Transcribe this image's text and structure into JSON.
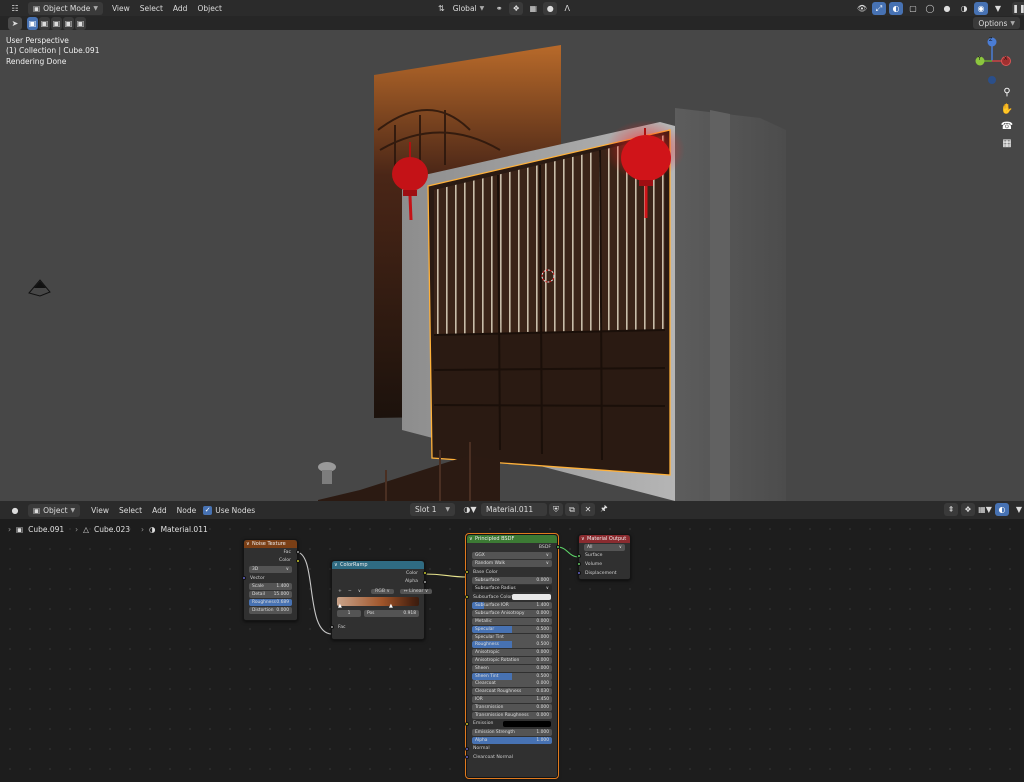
{
  "viewport_header": {
    "mode": "Object Mode",
    "menu": [
      "View",
      "Select",
      "Add",
      "Object"
    ],
    "orientation": "Global",
    "options_label": "Options"
  },
  "viewport": {
    "info": [
      "User Perspective",
      "(1) Collection | Cube.091",
      "Rendering Done"
    ],
    "gizmo": {
      "z": "Z",
      "y": "Y",
      "x": "X"
    }
  },
  "node_header": {
    "type": "Object",
    "menu": [
      "View",
      "Select",
      "Add",
      "Node"
    ],
    "use_nodes_label": "Use Nodes",
    "slot": "Slot 1",
    "material": "Material.011"
  },
  "breadcrumb": [
    "Cube.091",
    "Cube.023",
    "Material.011"
  ],
  "colors": {
    "accent": "#4772b3",
    "selection": "#e07a1e",
    "lantern": "#d4141b"
  },
  "nodes": {
    "noise": {
      "title": "Noise Texture",
      "outputs": [
        "Fac",
        "Color"
      ],
      "dimensions": "3D",
      "vector_label": "Vector",
      "fields": [
        {
          "label": "Scale",
          "value": "1.400"
        },
        {
          "label": "Detail",
          "value": "15.000"
        },
        {
          "label": "Roughness",
          "value": "0.689"
        },
        {
          "label": "Distortion",
          "value": "0.000"
        }
      ]
    },
    "colorramp": {
      "title": "ColorRamp",
      "outputs": [
        "Color",
        "Alpha"
      ],
      "add": "+",
      "remove": "−",
      "menu": "∨",
      "color_mode": "RGB",
      "interpolation": "Linear",
      "index": "1",
      "pos_label": "Pos",
      "pos_value": "0.918",
      "input": "Fac"
    },
    "bsdf": {
      "title": "Principled BSDF",
      "output": "BSDF",
      "distribution": "GGX",
      "subsurface_method": "Random Walk",
      "rows": [
        {
          "k": "sock",
          "label": "Base Color",
          "s": "yel"
        },
        {
          "k": "num",
          "label": "Subsurface",
          "value": "0.000",
          "s": "gray"
        },
        {
          "k": "sel",
          "label": "Subsurface Radius",
          "s": "pur"
        },
        {
          "k": "color",
          "label": "Subsurface Color",
          "s": "yel"
        },
        {
          "k": "num",
          "label": "Subsurface IOR",
          "value": "1.400",
          "s": "gray",
          "fill": 0.15
        },
        {
          "k": "num",
          "label": "Subsurface Anisotropy",
          "value": "0.000",
          "s": "gray"
        },
        {
          "k": "num",
          "label": "Metallic",
          "value": "0.000",
          "s": "gray"
        },
        {
          "k": "num",
          "label": "Specular",
          "value": "0.500",
          "s": "gray",
          "fill": 0.5
        },
        {
          "k": "num",
          "label": "Specular Tint",
          "value": "0.000",
          "s": "gray"
        },
        {
          "k": "num",
          "label": "Roughness",
          "value": "0.500",
          "s": "gray",
          "fill": 0.5
        },
        {
          "k": "num",
          "label": "Anisotropic",
          "value": "0.000",
          "s": "gray"
        },
        {
          "k": "num",
          "label": "Anisotropic Rotation",
          "value": "0.000",
          "s": "gray"
        },
        {
          "k": "num",
          "label": "Sheen",
          "value": "0.000",
          "s": "gray"
        },
        {
          "k": "num",
          "label": "Sheen Tint",
          "value": "0.500",
          "s": "gray",
          "fill": 0.5
        },
        {
          "k": "num",
          "label": "Clearcoat",
          "value": "0.000",
          "s": "gray"
        },
        {
          "k": "num",
          "label": "Clearcoat Roughness",
          "value": "0.030",
          "s": "gray"
        },
        {
          "k": "num",
          "label": "IOR",
          "value": "1.450",
          "s": "gray"
        },
        {
          "k": "num",
          "label": "Transmission",
          "value": "0.000",
          "s": "gray"
        },
        {
          "k": "num",
          "label": "Transmission Roughness",
          "value": "0.000",
          "s": "gray"
        },
        {
          "k": "dark",
          "label": "Emission",
          "s": "yel"
        },
        {
          "k": "num",
          "label": "Emission Strength",
          "value": "1.000",
          "s": "gray"
        },
        {
          "k": "num",
          "label": "Alpha",
          "value": "1.000",
          "s": "gray",
          "fill": 1
        },
        {
          "k": "sock",
          "label": "Normal",
          "s": "pur"
        },
        {
          "k": "sock",
          "label": "Clearcoat Normal",
          "s": "pur"
        }
      ]
    },
    "output": {
      "title": "Material Output",
      "target": "All",
      "inputs": [
        "Surface",
        "Volume",
        "Displacement"
      ]
    }
  }
}
